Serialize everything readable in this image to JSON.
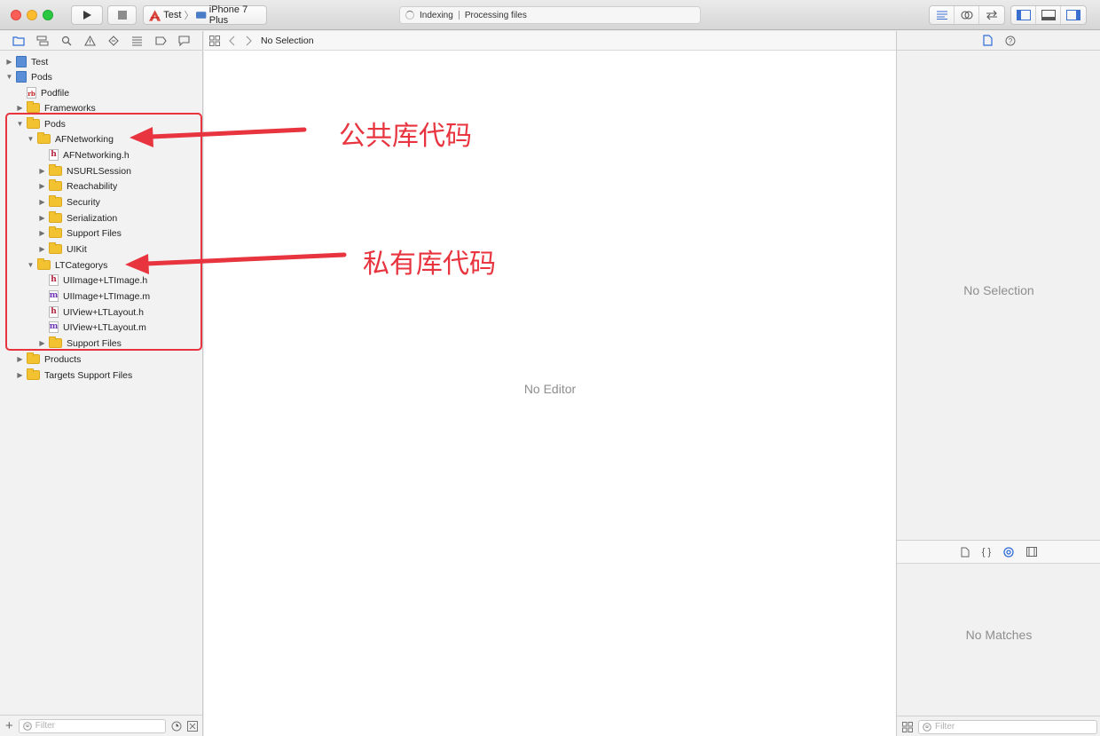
{
  "toolbar": {
    "scheme_name": "Test",
    "device_name": "iPhone 7 Plus",
    "activity_left": "Indexing",
    "activity_right": "Processing files"
  },
  "jump_bar": {
    "selection_label": "No Selection"
  },
  "navigator": {
    "rows": [
      {
        "label": "Test",
        "icon": "project-icon",
        "disclosure": "collapsed"
      },
      {
        "label": "Pods",
        "icon": "project-icon",
        "disclosure": "expanded"
      },
      {
        "label": "Podfile",
        "icon": "podfile-icon",
        "disclosure": "none"
      },
      {
        "label": "Frameworks",
        "icon": "folder-icon",
        "disclosure": "collapsed"
      },
      {
        "label": "Pods",
        "icon": "folder-icon",
        "disclosure": "expanded"
      },
      {
        "label": "AFNetworking",
        "icon": "folder-icon",
        "disclosure": "expanded"
      },
      {
        "label": "AFNetworking.h",
        "icon": "header-file-icon",
        "disclosure": "none"
      },
      {
        "label": "NSURLSession",
        "icon": "folder-icon",
        "disclosure": "collapsed"
      },
      {
        "label": "Reachability",
        "icon": "folder-icon",
        "disclosure": "collapsed"
      },
      {
        "label": "Security",
        "icon": "folder-icon",
        "disclosure": "collapsed"
      },
      {
        "label": "Serialization",
        "icon": "folder-icon",
        "disclosure": "collapsed"
      },
      {
        "label": "Support Files",
        "icon": "folder-icon",
        "disclosure": "collapsed"
      },
      {
        "label": "UIKit",
        "icon": "folder-icon",
        "disclosure": "collapsed"
      },
      {
        "label": "LTCategorys",
        "icon": "folder-icon",
        "disclosure": "expanded"
      },
      {
        "label": "UIImage+LTImage.h",
        "icon": "header-file-icon",
        "disclosure": "none"
      },
      {
        "label": "UIImage+LTImage.m",
        "icon": "source-file-icon",
        "disclosure": "none"
      },
      {
        "label": "UIView+LTLayout.h",
        "icon": "header-file-icon",
        "disclosure": "none"
      },
      {
        "label": "UIView+LTLayout.m",
        "icon": "source-file-icon",
        "disclosure": "none"
      },
      {
        "label": "Support Files",
        "icon": "folder-icon",
        "disclosure": "collapsed"
      },
      {
        "label": "Products",
        "icon": "folder-icon",
        "disclosure": "collapsed"
      },
      {
        "label": "Targets Support Files",
        "icon": "folder-icon",
        "disclosure": "collapsed"
      }
    ],
    "filter_placeholder": "Filter"
  },
  "editor": {
    "empty_label": "No Editor"
  },
  "inspector": {
    "empty_label": "No Selection"
  },
  "library": {
    "empty_label": "No Matches",
    "filter_placeholder": "Filter"
  },
  "annotations": {
    "public_label": "公共库代码",
    "private_label": "私有库代码",
    "color": "#e8343f"
  }
}
